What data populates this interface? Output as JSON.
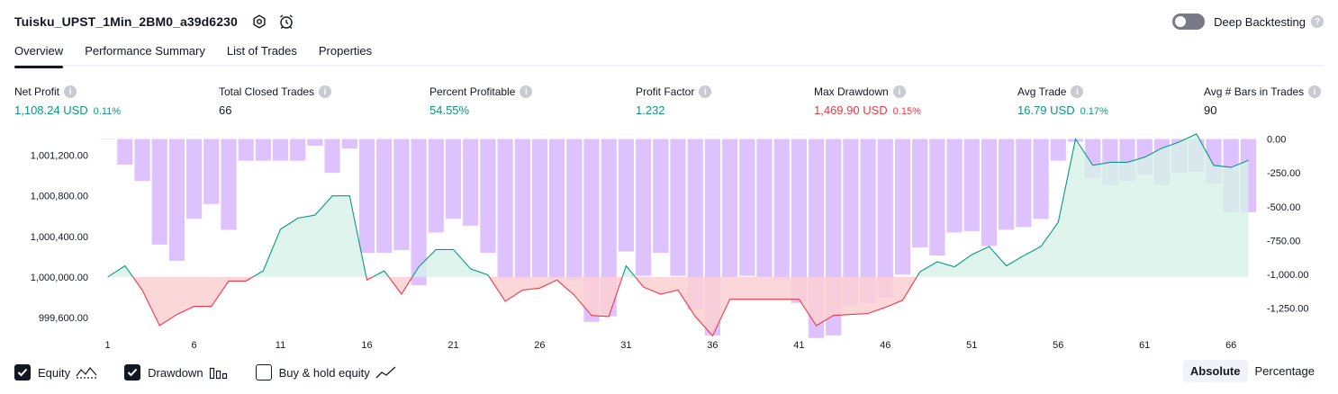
{
  "header": {
    "strategy_name": "Tuisku_UPST_1Min_2BM0_a39d6230",
    "deep_backtesting_label": "Deep Backtesting",
    "deep_backtesting_on": false
  },
  "tabs": [
    {
      "label": "Overview",
      "active": true
    },
    {
      "label": "Performance Summary",
      "active": false
    },
    {
      "label": "List of Trades",
      "active": false
    },
    {
      "label": "Properties",
      "active": false
    }
  ],
  "stats": {
    "net_profit": {
      "title": "Net Profit",
      "value": "1,108.24 USD",
      "pct": "0.11%"
    },
    "total_closed_trades": {
      "title": "Total Closed Trades",
      "value": "66"
    },
    "percent_profitable": {
      "title": "Percent Profitable",
      "value": "54.55%"
    },
    "profit_factor": {
      "title": "Profit Factor",
      "value": "1.232"
    },
    "max_drawdown": {
      "title": "Max Drawdown",
      "value": "1,469.90 USD",
      "pct": "0.15%"
    },
    "avg_trade": {
      "title": "Avg Trade",
      "value": "16.79 USD",
      "pct": "0.17%"
    },
    "avg_bars": {
      "title": "Avg # Bars in Trades",
      "value": "90"
    }
  },
  "legend": {
    "equity_label": "Equity",
    "drawdown_label": "Drawdown",
    "buy_hold_label": "Buy & hold equity",
    "equity_checked": true,
    "drawdown_checked": true,
    "buy_hold_checked": false
  },
  "modes": {
    "absolute": "Absolute",
    "percentage": "Percentage"
  },
  "colors": {
    "positive": "#089981",
    "negative": "#f23645",
    "drawdown_bar": "#c99cff",
    "equity_fill_pos": "#d6f1e9",
    "equity_fill_neg": "#fbd0d4",
    "equity_line_alt": "#2962ff"
  },
  "chart_data": {
    "type": "area",
    "x": [
      1,
      2,
      3,
      4,
      5,
      6,
      7,
      8,
      9,
      10,
      11,
      12,
      13,
      14,
      15,
      16,
      17,
      18,
      19,
      20,
      21,
      22,
      23,
      24,
      25,
      26,
      27,
      28,
      29,
      30,
      31,
      32,
      33,
      34,
      35,
      36,
      37,
      38,
      39,
      40,
      41,
      42,
      43,
      44,
      45,
      46,
      47,
      48,
      49,
      50,
      51,
      52,
      53,
      54,
      55,
      56,
      57,
      58,
      59,
      60,
      61,
      62,
      63,
      64,
      65,
      66,
      67
    ],
    "x_ticks": [
      1,
      6,
      11,
      16,
      21,
      26,
      31,
      36,
      41,
      46,
      51,
      56,
      61,
      66
    ],
    "equity_baseline": 1000000,
    "equity_axis": {
      "ylim": [
        999520,
        1001400
      ],
      "ticks": [
        999600,
        1000000,
        1000400,
        1000800,
        1001200
      ],
      "tick_labels": [
        "999,600.00",
        "1,000,000.00",
        "1,000,400.00",
        "1,000,800.00",
        "1,001,200.00"
      ]
    },
    "drawdown_axis": {
      "ylim": [
        -1378,
        30
      ],
      "ticks": [
        0,
        -250,
        -500,
        -750,
        -1000,
        -1250
      ],
      "tick_labels": [
        "0.00",
        "-250.00",
        "-500.00",
        "-750.00",
        "-1,000.00",
        "-1,250.00"
      ]
    },
    "series": [
      {
        "name": "Equity",
        "values": [
          1000000,
          1000110,
          999870,
          999520,
          999630,
          999710,
          999710,
          999960,
          999960,
          1000060,
          1000470,
          1000580,
          1000610,
          1000800,
          1000800,
          999970,
          1000060,
          999830,
          1000100,
          1000270,
          1000270,
          1000080,
          1000020,
          999760,
          999870,
          999890,
          999970,
          999820,
          999620,
          999610,
          1000110,
          999900,
          999830,
          999870,
          999610,
          999420,
          999780,
          999780,
          999780,
          999780,
          999780,
          999520,
          999620,
          999630,
          999640,
          999700,
          999770,
          1000050,
          1000150,
          1000100,
          1000220,
          1000300,
          1000110,
          1000210,
          1000300,
          1000540,
          1001360,
          1001100,
          1001130,
          1001130,
          1001180,
          1001270,
          1001330,
          1001410,
          1001100,
          1001080,
          1001150
        ]
      },
      {
        "name": "Drawdown",
        "values": [
          0,
          -190,
          -310,
          -780,
          -900,
          -590,
          -480,
          -670,
          -160,
          -160,
          -160,
          -160,
          -50,
          -250,
          -70,
          -840,
          -840,
          -820,
          -1080,
          -690,
          -590,
          -640,
          -840,
          -1030,
          -1030,
          -1020,
          -1030,
          -1040,
          -1350,
          -1310,
          -830,
          -1010,
          -840,
          -1010,
          -1260,
          -1450,
          -1020,
          -1010,
          -1020,
          -1040,
          -1210,
          -1470,
          -1450,
          -1230,
          -1210,
          -1170,
          -1000,
          -800,
          -860,
          -690,
          -680,
          -790,
          -670,
          -650,
          -590,
          -160,
          -20,
          -290,
          -340,
          -310,
          -260,
          -340,
          -250,
          -240,
          -330,
          -540,
          -540
        ]
      }
    ],
    "title": "",
    "xlabel": "",
    "ylabel": "",
    "grid": false
  }
}
